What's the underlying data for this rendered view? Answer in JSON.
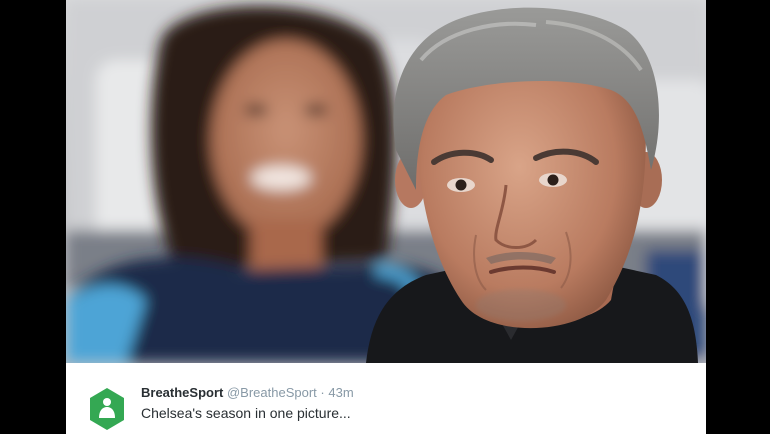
{
  "tweet": {
    "display_name": "BreatheSport",
    "handle": "@BreatheSport",
    "separator": "·",
    "timestamp": "43m",
    "text": "Chelsea's season in one picture..."
  },
  "colors": {
    "letterbox": "#000000",
    "avatar_green": "#34a853",
    "tweet_background": "#ffffff",
    "name_color": "#292f33",
    "meta_color": "#8899a6"
  },
  "photo": {
    "icon": "photo-image"
  }
}
